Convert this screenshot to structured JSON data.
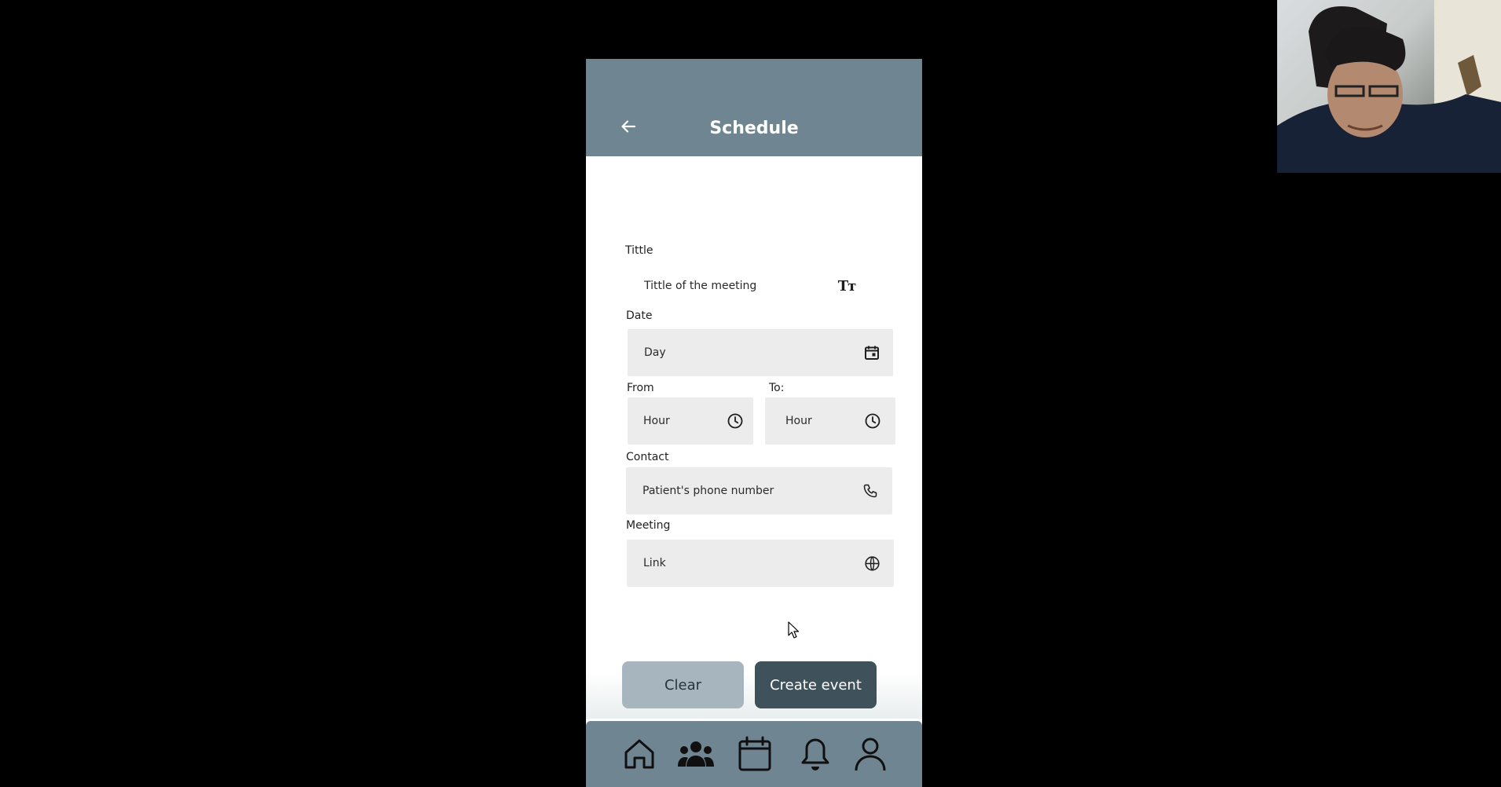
{
  "app": {
    "title": "Schedule"
  },
  "form": {
    "title_label": "Tittle",
    "title_placeholder": "Tittle of the meeting",
    "date_label": "Date",
    "date_placeholder": "Day",
    "from_label": "From",
    "from_placeholder": "Hour",
    "to_label": "To:",
    "to_placeholder": "Hour",
    "contact_label": "Contact",
    "contact_placeholder": "Patient's phone number",
    "meeting_label": "Meeting",
    "meeting_placeholder": "Link"
  },
  "actions": {
    "clear_label": "Clear",
    "create_label": "Create event"
  },
  "icons": {
    "back": "arrow-left-icon",
    "title_field": "text-size-icon",
    "date_field": "calendar-event-icon",
    "from_field": "clock-icon",
    "to_field": "clock-icon",
    "contact_field": "phone-icon",
    "meeting_field": "globe-icon"
  },
  "nav": {
    "items": [
      "home-icon",
      "group-icon",
      "calendar-icon",
      "bell-icon",
      "person-icon"
    ]
  },
  "colors": {
    "header": "#6f8591",
    "field_bg": "#ececec",
    "clear_button": "#a7b5bf",
    "create_button": "#3f525b"
  }
}
